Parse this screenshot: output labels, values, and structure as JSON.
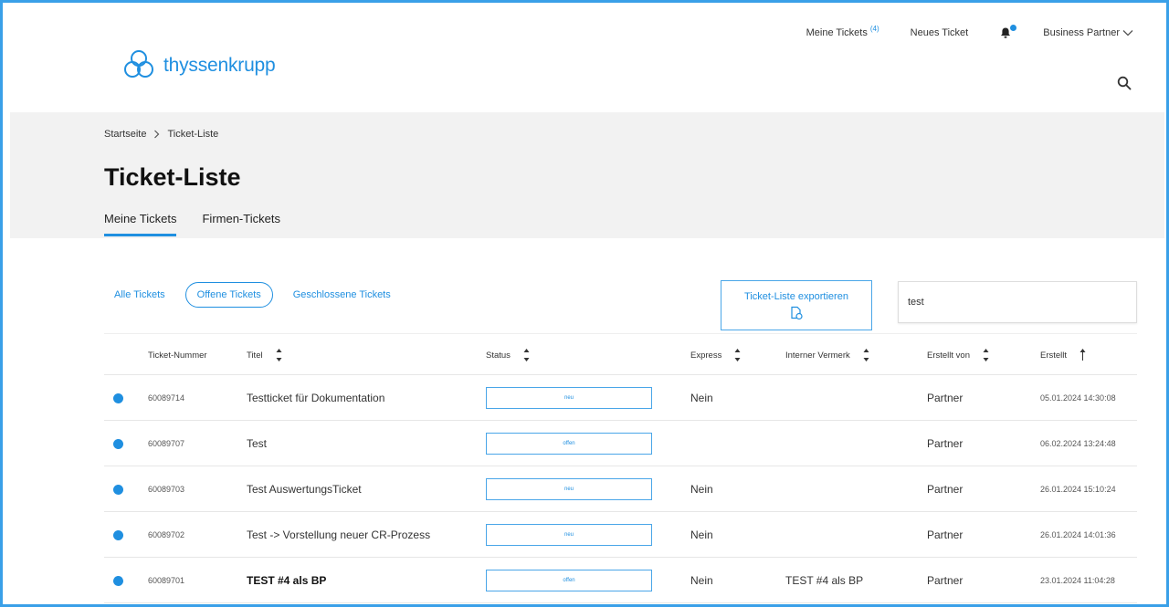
{
  "brand": {
    "logo_text": "thyssenkrupp",
    "color": "#1f8fe0"
  },
  "topnav": {
    "my_tickets": "Meine Tickets",
    "my_tickets_badge": "(4)",
    "new_ticket": "Neues Ticket",
    "business_partner": "Business Partner"
  },
  "breadcrumb": {
    "home": "Startseite",
    "current": "Ticket-Liste"
  },
  "page": {
    "title": "Ticket-Liste"
  },
  "tabs": [
    {
      "label": "Meine Tickets",
      "active": true
    },
    {
      "label": "Firmen-Tickets",
      "active": false
    }
  ],
  "filters": {
    "all": "Alle Tickets",
    "open": "Offene Tickets",
    "closed": "Geschlossene Tickets"
  },
  "export": {
    "label": "Ticket-Liste exportieren"
  },
  "search": {
    "value": "test"
  },
  "columns": [
    "Ticket-Nummer",
    "Titel",
    "Status",
    "Express",
    "Interner Vermerk",
    "Erstellt von",
    "Erstellt"
  ],
  "rows": [
    {
      "number": "60089714",
      "title": "Testticket für Dokumentation",
      "status": "neu",
      "express": "Nein",
      "note": "",
      "created_by": "Partner",
      "created": "05.01.2024 14:30:08",
      "bold": false
    },
    {
      "number": "60089707",
      "title": "Test",
      "status": "offen",
      "express": "",
      "note": "",
      "created_by": "Partner",
      "created": "06.02.2024 13:24:48",
      "bold": false
    },
    {
      "number": "60089703",
      "title": "Test AuswertungsTicket",
      "status": "neu",
      "express": "Nein",
      "note": "",
      "created_by": "Partner",
      "created": "26.01.2024 15:10:24",
      "bold": false
    },
    {
      "number": "60089702",
      "title": "Test -> Vorstellung neuer CR-Prozess",
      "status": "neu",
      "express": "Nein",
      "note": "",
      "created_by": "Partner",
      "created": "26.01.2024 14:01:36",
      "bold": false
    },
    {
      "number": "60089701",
      "title": "TEST #4 als BP",
      "status": "offen",
      "express": "Nein",
      "note": "TEST #4 als BP",
      "created_by": "Partner",
      "created": "23.01.2024 11:04:28",
      "bold": true
    }
  ]
}
